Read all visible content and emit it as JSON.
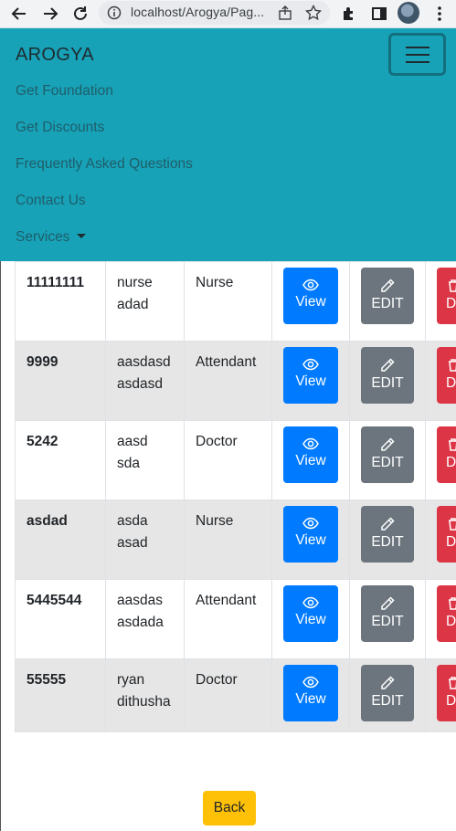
{
  "browser": {
    "url": "localhost/Arogya/Pag..."
  },
  "navbar": {
    "brand": "AROGYA",
    "links": [
      "Get Foundation",
      "Get Discounts",
      "Frequently Asked Questions",
      "Contact Us",
      "Services"
    ],
    "color": "#17a2b8"
  },
  "table": {
    "rows": [
      {
        "id": "11111111",
        "name_line1": "nurse",
        "name_line2": "adad",
        "role": "Nurse"
      },
      {
        "id": "9999",
        "name_line1": "aasdasd",
        "name_line2": "asdasd",
        "role": "Attendant"
      },
      {
        "id": "5242",
        "name_line1": "aasd",
        "name_line2": "sda",
        "role": "Doctor"
      },
      {
        "id": "asdad",
        "name_line1": "asda",
        "name_line2": "asad",
        "role": "Nurse"
      },
      {
        "id": "5445544",
        "name_line1": "aasdas",
        "name_line2": "asdada",
        "role": "Attendant"
      },
      {
        "id": "55555",
        "name_line1": "ryan",
        "name_line2": "dithusha",
        "role": "Doctor"
      }
    ],
    "view_label": "View",
    "edit_label": "EDIT",
    "delete_label": "D"
  },
  "back_label": "Back",
  "icons": [
    "back-arrow-icon",
    "forward-arrow-icon",
    "reload-icon",
    "info-icon",
    "share-icon",
    "star-icon",
    "extensions-icon",
    "sidepanel-icon",
    "menu-dots-icon",
    "hamburger-icon",
    "eye-icon",
    "pencil-icon"
  ]
}
